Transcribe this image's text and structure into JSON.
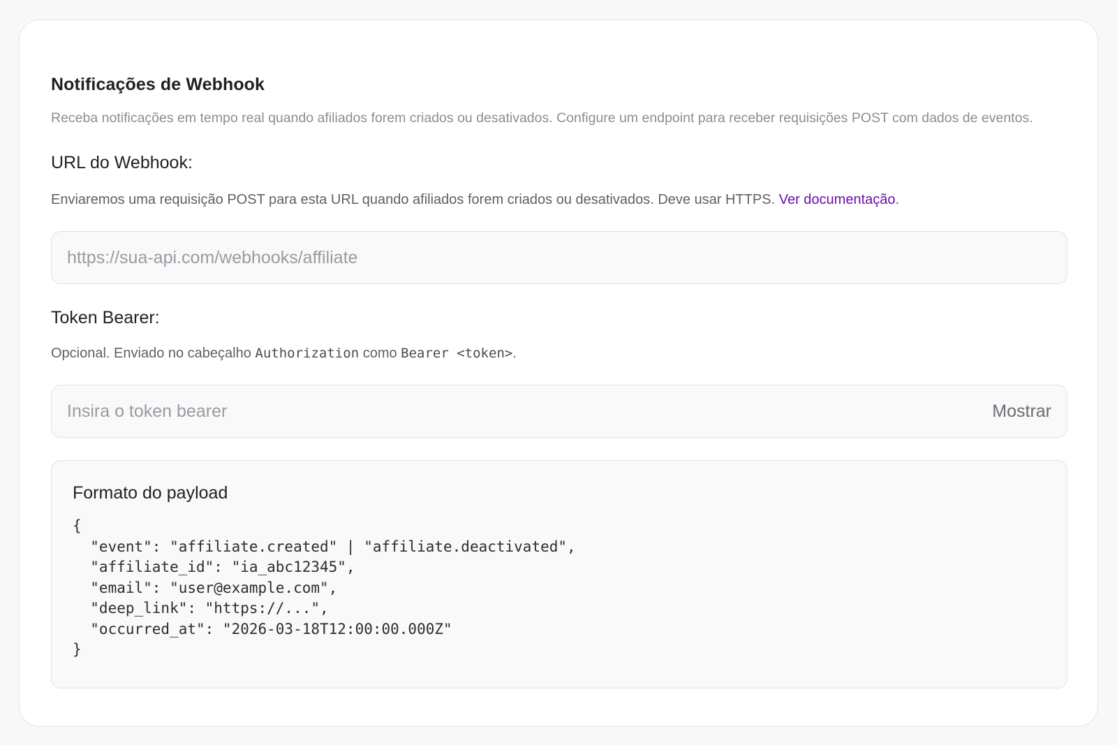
{
  "webhook": {
    "title": "Notificações de Webhook",
    "description": "Receba notificações em tempo real quando afiliados forem criados ou desativados. Configure um endpoint para receber requisições POST com dados de eventos.",
    "url_field": {
      "label": "URL do Webhook:",
      "help_text": "Enviaremos uma requisição POST para esta URL quando afiliados forem criados ou desativados. Deve usar HTTPS. ",
      "help_link": "Ver documentação",
      "help_suffix": ".",
      "placeholder": "https://sua-api.com/webhooks/affiliate",
      "value": ""
    },
    "token_field": {
      "label": "Token Bearer:",
      "help_prefix": "Opcional. Enviado no cabeçalho ",
      "help_code_1": "Authorization",
      "help_middle": " como ",
      "help_code_2": "Bearer <token>",
      "help_suffix": ".",
      "placeholder": "Insira o token bearer",
      "value": "",
      "show_label": "Mostrar"
    },
    "payload": {
      "title": "Formato do payload",
      "code": "{\n  \"event\": \"affiliate.created\" | \"affiliate.deactivated\",\n  \"affiliate_id\": \"ia_abc12345\",\n  \"email\": \"user@example.com\",\n  \"deep_link\": \"https://...\",\n  \"occurred_at\": \"2026-03-18T12:00:00.000Z\"\n}"
    }
  },
  "colors": {
    "link": "#6b0fa8",
    "muted_text": "#8c8c96",
    "input_bg": "#f9f9fa",
    "border": "#e2e2e6"
  }
}
